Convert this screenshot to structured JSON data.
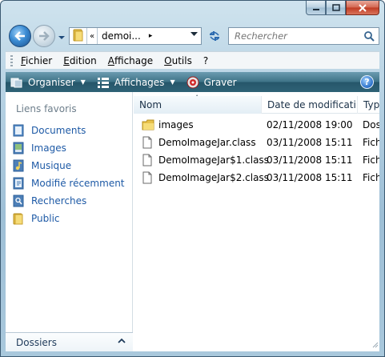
{
  "address": {
    "overflow_label": "«",
    "path": "demoi...",
    "crumb_arrow": "▸"
  },
  "search": {
    "placeholder": "Rechercher"
  },
  "menu": {
    "items": [
      "Fichier",
      "Edition",
      "Affichage",
      "Outils",
      "?"
    ]
  },
  "commands": {
    "organize": "Organiser",
    "views": "Affichages",
    "burn": "Graver",
    "help": "?"
  },
  "nav": {
    "heading": "Liens favoris",
    "items": [
      {
        "label": "Documents",
        "icon": "documents-icon"
      },
      {
        "label": "Images",
        "icon": "images-icon"
      },
      {
        "label": "Musique",
        "icon": "music-icon"
      },
      {
        "label": "Modifié récemment",
        "icon": "recent-icon"
      },
      {
        "label": "Recherches",
        "icon": "searches-icon"
      },
      {
        "label": "Public",
        "icon": "public-folder-icon"
      }
    ],
    "folders_label": "Dossiers"
  },
  "files": {
    "columns": [
      "Nom",
      "Date de modificati...",
      "Type"
    ],
    "rows": [
      {
        "name": "images",
        "date": "02/11/2008 19:00",
        "type": "Dos",
        "icon": "folder-icon"
      },
      {
        "name": "DemoImageJar.class",
        "date": "03/11/2008 15:11",
        "type": "Fich",
        "icon": "file-icon"
      },
      {
        "name": "DemoImageJar$1.class",
        "date": "03/11/2008 15:11",
        "type": "Fich",
        "icon": "file-icon"
      },
      {
        "name": "DemoImageJar$2.class",
        "date": "03/11/2008 15:11",
        "type": "Fich",
        "icon": "file-icon"
      }
    ]
  },
  "colors": {
    "link": "#1e5aa6",
    "command_bar": "#2f6276",
    "frame": "#b4d0e2"
  }
}
